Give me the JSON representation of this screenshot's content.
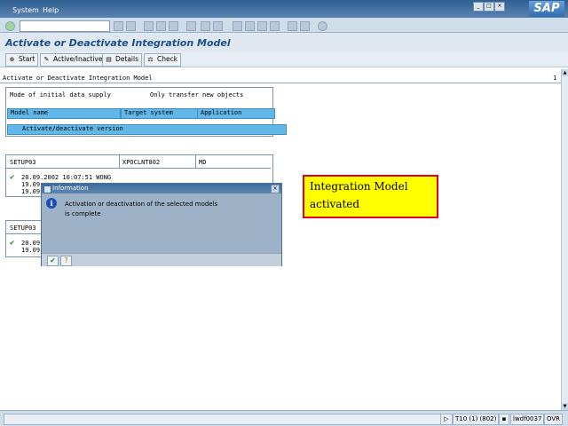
{
  "menubar": {
    "items": [
      "System",
      "Help"
    ],
    "logo": "SAP"
  },
  "title": "Activate or Deactivate Integration Model",
  "app_toolbar": {
    "start": "Start",
    "active_inactive": "Active/Inactive",
    "details": "Details",
    "check": "Check"
  },
  "report": {
    "header": "Activate or Deactivate Integration Model",
    "page_number": "1",
    "initial_supply_label": "Mode of initial data supply",
    "initial_supply_value": "Only transfer new objects",
    "columns": [
      "Model name",
      "Target system",
      "Application"
    ],
    "version_header": "Activate/deactivate version",
    "block1": {
      "model": "SETUP03",
      "target": "XPOCLNT802",
      "app": "MD",
      "line1": "20.09.2002 10:07:51 WONG",
      "line2": "19.09",
      "line3": "19.09"
    },
    "block2": {
      "model": "SETUP03",
      "line1": "20.09",
      "line2": "19.09"
    }
  },
  "popup": {
    "title": "Information",
    "line1": "Activation or deactivation of the selected models",
    "line2": "is complete"
  },
  "annotation": {
    "line1": "Integration Model",
    "line2": "activated"
  },
  "statusbar": {
    "system": "T10 (1) (802)",
    "server": "lwdf0037",
    "mode": "OVR"
  },
  "colors": {
    "field_highlight": "#63b7e6",
    "title": "#1f4f86",
    "annotation_bg": "#ffff00",
    "annotation_border": "#e0001a"
  }
}
